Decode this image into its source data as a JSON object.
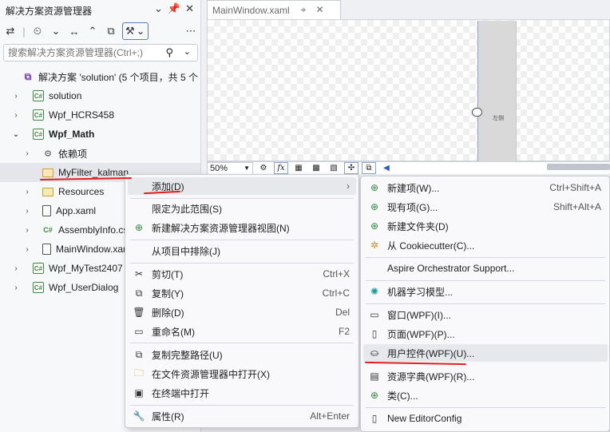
{
  "solution_explorer": {
    "title": "解决方案资源管理器",
    "title_icons": [
      "pin-icon",
      "close-icon"
    ],
    "search_placeholder": "搜索解决方案资源管理器(Ctrl+;)",
    "tree": [
      {
        "label": "解决方案 'solution' (5 个项目，共 5 个",
        "icon": "solution-icon",
        "bold": false
      },
      {
        "label": "solution",
        "icon": "csharp-project-icon"
      },
      {
        "label": "Wpf_HCRS458",
        "icon": "csharp-project-icon"
      },
      {
        "label": "Wpf_Math",
        "icon": "csharp-project-icon",
        "bold": true
      },
      {
        "label": "依赖项",
        "icon": "dependencies-icon"
      },
      {
        "label": "MyFilter_kalman",
        "icon": "folder-icon"
      },
      {
        "label": "Resources",
        "icon": "folder-icon"
      },
      {
        "label": "App.xaml",
        "icon": "xaml-file-icon"
      },
      {
        "label": "AssemblyInfo.cs",
        "icon": "csharp-file-icon"
      },
      {
        "label": "MainWindow.xaml",
        "icon": "xaml-file-icon"
      },
      {
        "label": "Wpf_MyTest2407",
        "icon": "csharp-project-icon"
      },
      {
        "label": "Wpf_UserDialog",
        "icon": "csharp-project-icon"
      }
    ]
  },
  "editor": {
    "tab_label": "MainWindow.xaml",
    "panel_label": "左侧",
    "zoom": "50%",
    "fx_label": "fx"
  },
  "context_menu": [
    {
      "label": "添加(D)",
      "shortcut": "",
      "icon": "",
      "submenu": true
    },
    {
      "label": "限定为此范围(S)",
      "shortcut": "",
      "icon": ""
    },
    {
      "label": "新建解决方案资源管理器视图(N)",
      "shortcut": "",
      "icon": "new-view-icon"
    },
    {
      "label": "从项目中排除(J)",
      "shortcut": "",
      "icon": ""
    },
    {
      "label": "剪切(T)",
      "shortcut": "Ctrl+X",
      "icon": "scissors-icon"
    },
    {
      "label": "复制(Y)",
      "shortcut": "Ctrl+C",
      "icon": "copy-icon"
    },
    {
      "label": "删除(D)",
      "shortcut": "Del",
      "icon": "trash-icon"
    },
    {
      "label": "重命名(M)",
      "shortcut": "F2",
      "icon": "rename-icon"
    },
    {
      "label": "复制完整路径(U)",
      "shortcut": "",
      "icon": "copy-path-icon"
    },
    {
      "label": "在文件资源管理器中打开(X)",
      "shortcut": "",
      "icon": "open-folder-icon"
    },
    {
      "label": "在终端中打开",
      "shortcut": "",
      "icon": "terminal-icon"
    },
    {
      "label": "属性(R)",
      "shortcut": "Alt+Enter",
      "icon": "wrench-icon"
    }
  ],
  "submenu": [
    {
      "label": "新建项(W)...",
      "shortcut": "Ctrl+Shift+A",
      "icon": "new-item-icon"
    },
    {
      "label": "现有项(G)...",
      "shortcut": "Shift+Alt+A",
      "icon": "existing-item-icon"
    },
    {
      "label": "新建文件夹(D)",
      "shortcut": "",
      "icon": "new-folder-icon"
    },
    {
      "label": "从 Cookiecutter(C)...",
      "shortcut": "",
      "icon": "cookiecutter-icon"
    },
    {
      "label": "Aspire Orchestrator Support...",
      "shortcut": "",
      "icon": ""
    },
    {
      "label": "机器学习模型...",
      "shortcut": "",
      "icon": "ml-model-icon"
    },
    {
      "label": "窗口(WPF)(I)...",
      "shortcut": "",
      "icon": "window-icon"
    },
    {
      "label": "页面(WPF)(P)...",
      "shortcut": "",
      "icon": "page-icon"
    },
    {
      "label": "用户控件(WPF)(U)...",
      "shortcut": "",
      "icon": "user-control-icon"
    },
    {
      "label": "资源字典(WPF)(R)...",
      "shortcut": "",
      "icon": "resource-dictionary-icon"
    },
    {
      "label": "类(C)...",
      "shortcut": "",
      "icon": "class-icon"
    },
    {
      "label": "New EditorConfig",
      "shortcut": "",
      "icon": "editorconfig-icon"
    }
  ],
  "colors": {
    "selection_marker": "#5b3fcc",
    "annotation_red": "#e02020"
  }
}
